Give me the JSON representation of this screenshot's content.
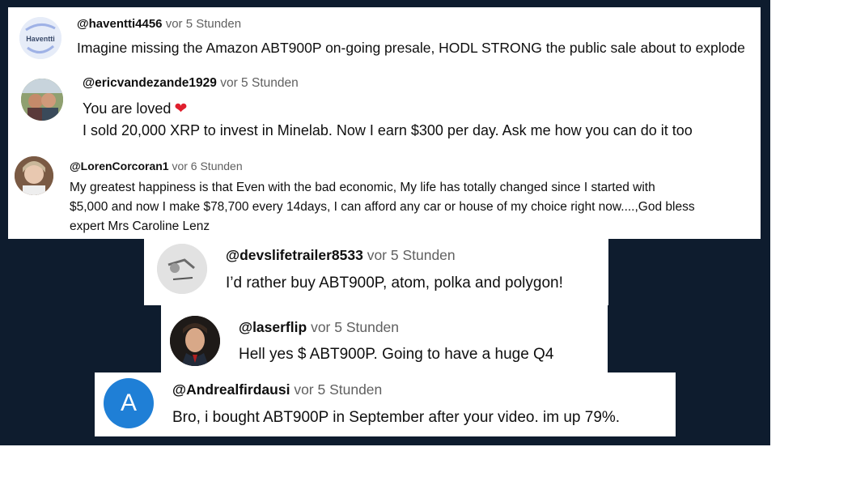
{
  "comments": [
    {
      "handle": "@haventti4456",
      "time": "vor 5 Stunden",
      "avatar_label": "Haventti",
      "lines": [
        "Imagine missing the Amazon ABT900P on-going presale, HODL STRONG the public sale about to explode"
      ]
    },
    {
      "handle": "@ericvandezande1929",
      "time": "vor 5 Stunden",
      "lines": [
        "You are loved",
        "I sold 20,000 XRP to invest in Minelab. Now I earn $300 per day. Ask me how you can do it too"
      ]
    },
    {
      "handle": "@LorenCorcoran1",
      "time": "vor 6 Stunden",
      "lines": [
        "My greatest happiness is that Even with the bad economic, My life has totally changed since I started with",
        "$5,000 and now I make $78,700 every 14days, I can afford any car or house of my choice right now....,God bless",
        "expert Mrs Caroline Lenz"
      ]
    },
    {
      "handle": "@devslifetrailer8533",
      "time": "vor 5 Stunden",
      "lines": [
        "I’d rather buy ABT900P, atom, polka and polygon!"
      ]
    },
    {
      "handle": "@laserflip",
      "time": "vor 5 Stunden",
      "lines": [
        "Hell yes $ ABT900P. Going to have a huge Q4"
      ]
    },
    {
      "handle": "@Andrealfirdausi",
      "time": "vor 5 Stunden",
      "avatar_letter": "A",
      "lines": [
        "Bro, i bought ABT900P in September after your video. im up 79%."
      ]
    }
  ],
  "colors": {
    "backdrop": "#0e1c2e",
    "heart": "#e0202e",
    "avatar_blue": "#1f7fd6"
  }
}
